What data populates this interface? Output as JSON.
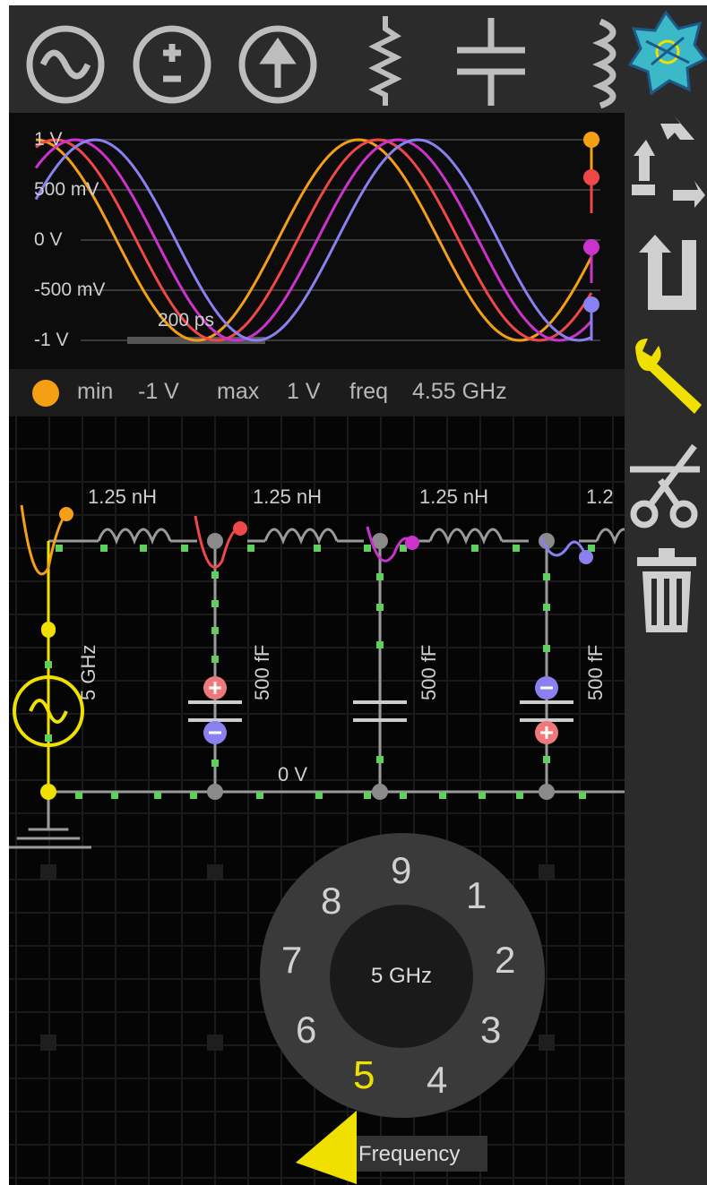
{
  "toolbar": {
    "components": [
      {
        "name": "ac-source-icon"
      },
      {
        "name": "dc-voltage-source-icon"
      },
      {
        "name": "current-source-icon"
      },
      {
        "name": "resistor-icon"
      },
      {
        "name": "capacitor-icon"
      },
      {
        "name": "inductor-icon"
      }
    ],
    "actions": [
      {
        "name": "app-logo-icon"
      },
      {
        "name": "rotate-icon"
      },
      {
        "name": "undo-icon"
      },
      {
        "name": "wrench-icon"
      },
      {
        "name": "cut-icon"
      },
      {
        "name": "trash-icon"
      }
    ]
  },
  "scope": {
    "y_labels": [
      "1 V",
      "500 mV",
      "0 V",
      "-500 mV",
      "-1 V"
    ],
    "time_scale": "200 ps",
    "trace_colors": [
      "#f5a014",
      "#f04848",
      "#cc33cc",
      "#8a80f0"
    ],
    "info": {
      "min_label": "min",
      "min_value": "-1 V",
      "max_label": "max",
      "max_value": "1 V",
      "freq_label": "freq",
      "freq_value": "4.55 GHz"
    }
  },
  "circuit": {
    "inductors": [
      "1.25 nH",
      "1.25 nH",
      "1.25 nH",
      "1.2"
    ],
    "source_freq": "5 GHz",
    "capacitors": [
      "500 fF",
      "500 fF",
      "500 fF"
    ],
    "ground_label": "0 V"
  },
  "dial": {
    "center": "5 GHz",
    "digits": [
      "9",
      "1",
      "2",
      "3",
      "4",
      "5",
      "6",
      "7",
      "8"
    ],
    "selected": "5",
    "field_label": "Frequency"
  },
  "colors": {
    "highlight": "#f0e000",
    "wire": "#9a9a9a",
    "node": "#5fd05f"
  }
}
